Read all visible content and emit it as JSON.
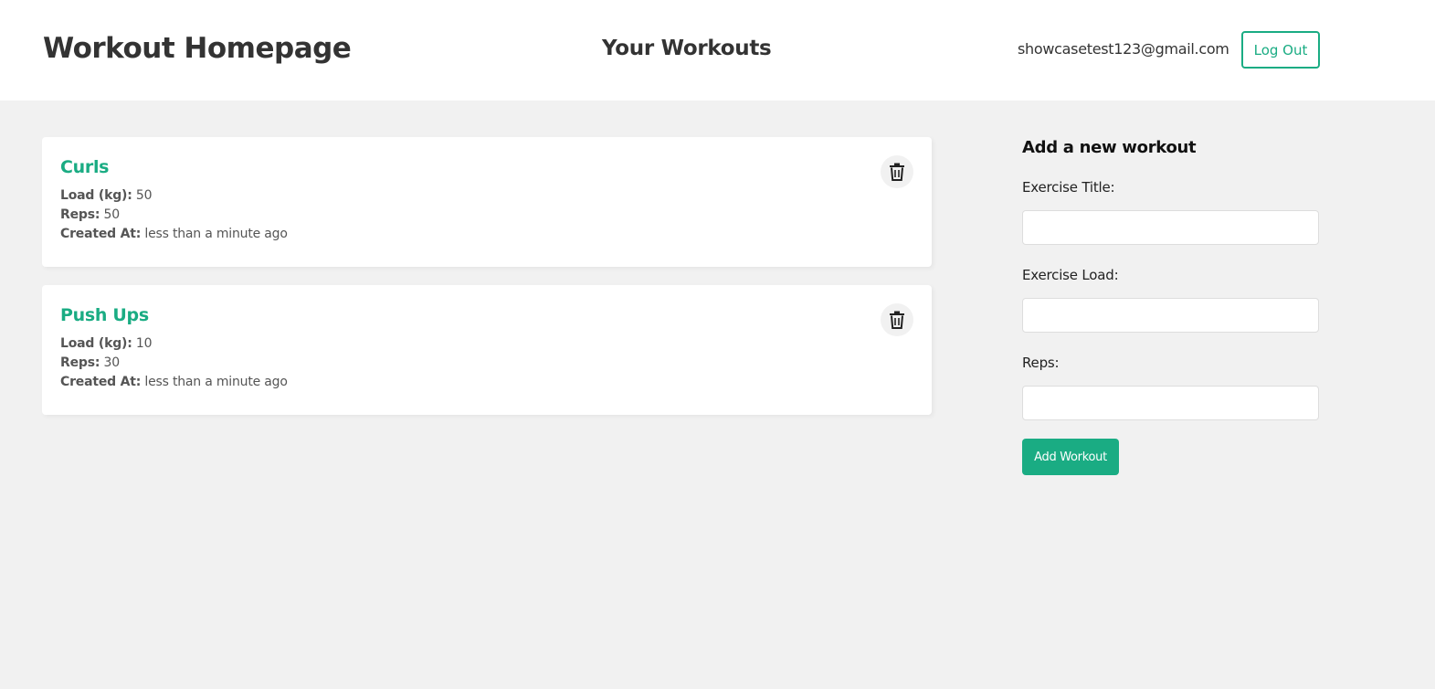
{
  "header": {
    "site_title": "Workout Homepage",
    "page_heading": "Your Workouts",
    "user_email": "showcasetest123@gmail.com",
    "logout_label": "Log Out"
  },
  "workouts": [
    {
      "title": "Curls",
      "load_label": "Load (kg):",
      "load_value": "50",
      "reps_label": "Reps:",
      "reps_value": "50",
      "created_label": "Created At:",
      "created_value": "less than a minute ago",
      "delete_icon": "trash-icon"
    },
    {
      "title": "Push Ups",
      "load_label": "Load (kg):",
      "load_value": "10",
      "reps_label": "Reps:",
      "reps_value": "30",
      "created_label": "Created At:",
      "created_value": "less than a minute ago",
      "delete_icon": "trash-icon"
    }
  ],
  "form": {
    "heading": "Add a new workout",
    "title_label": "Exercise Title:",
    "title_value": "",
    "load_label": "Exercise Load:",
    "load_value": "",
    "reps_label": "Reps:",
    "reps_value": "",
    "submit_label": "Add Workout"
  },
  "colors": {
    "primary": "#1aac83",
    "background": "#f1f1f1",
    "card": "#ffffff",
    "text": "#333333"
  }
}
